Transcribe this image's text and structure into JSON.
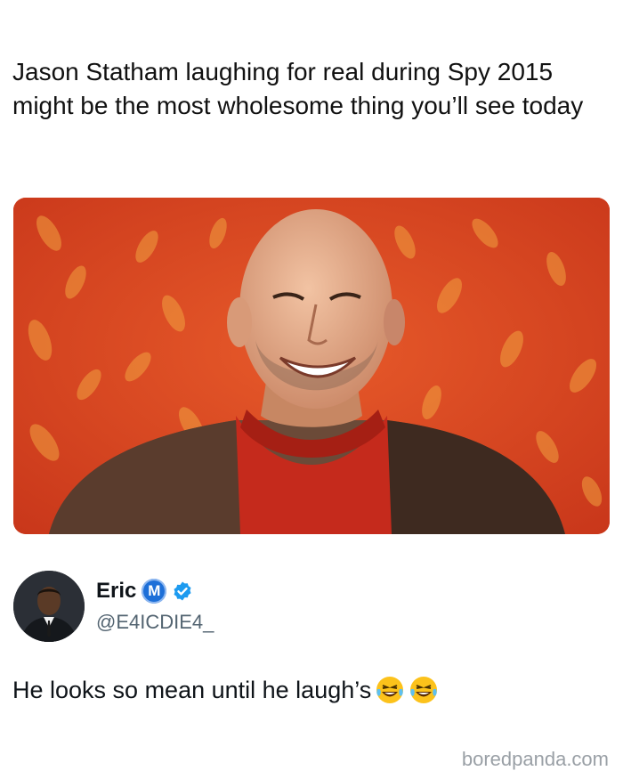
{
  "post": {
    "caption": "Jason Statham laughing for real during Spy 2015 might be the most wholesome thing you’ll see today",
    "text": "He looks so mean until he laugh’s",
    "emoji": [
      "laughing-tears-emoji",
      "laughing-tears-emoji"
    ]
  },
  "author": {
    "display_name": "Eric",
    "badge_letter": "M",
    "handle": "@E4ICDIE4_",
    "verified": true
  },
  "watermark": "boredpanda.com",
  "colors": {
    "verified_blue": "#1d9bf0",
    "badge_blue": "#1d6fd8",
    "photo_background": "#d8431c",
    "handle_gray": "#536471"
  }
}
